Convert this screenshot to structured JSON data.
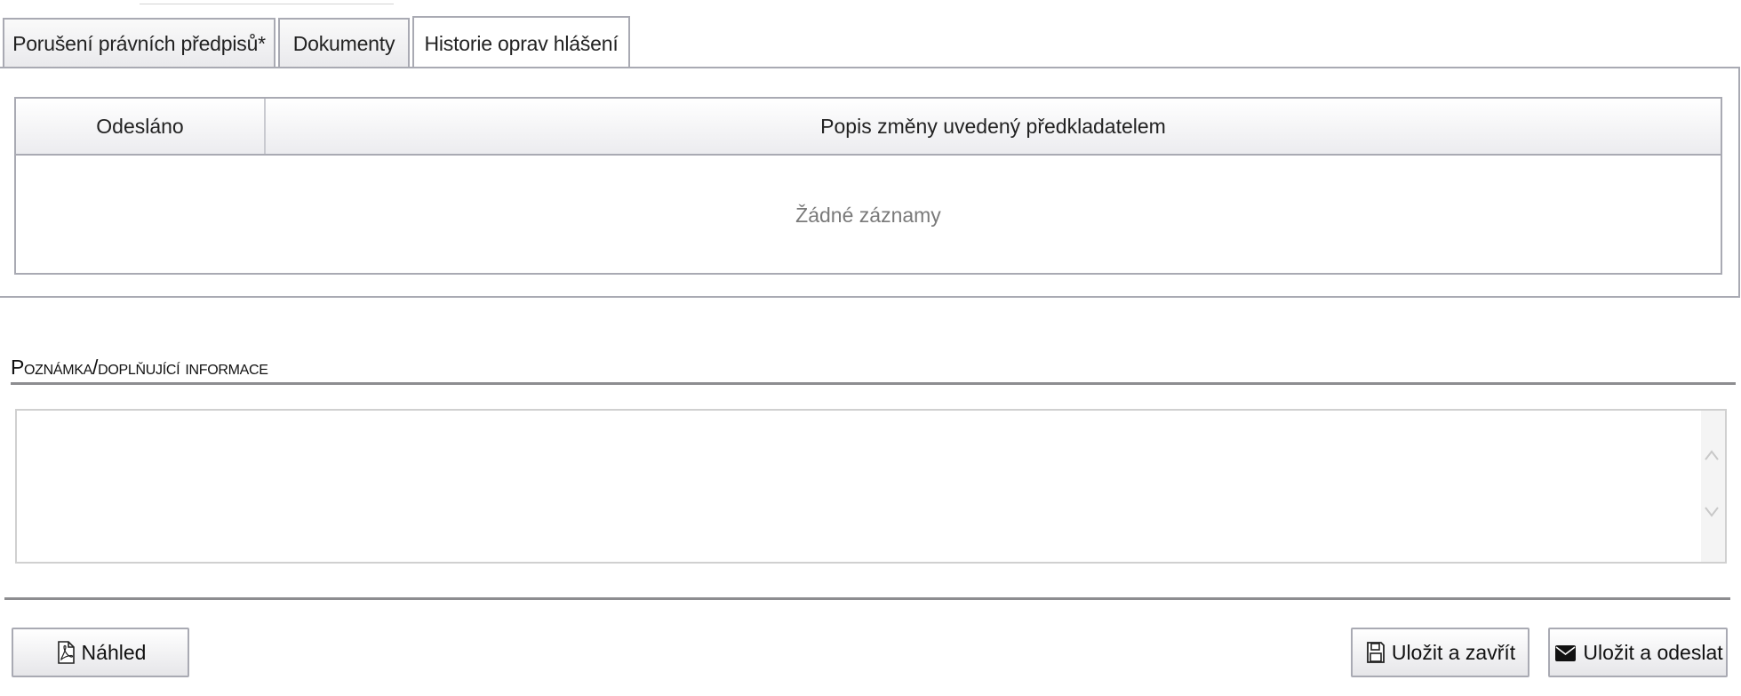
{
  "tabs": [
    {
      "label": "Porušení právních předpisů*"
    },
    {
      "label": "Dokumenty"
    },
    {
      "label": "Historie oprav hlášení",
      "active": true
    }
  ],
  "history_table": {
    "columns": [
      "Odesláno",
      "Popis změny uvedený předkladatelem"
    ],
    "empty_text": "Žádné záznamy"
  },
  "note_section": {
    "title": "Poznámka/doplňující informace",
    "value": ""
  },
  "buttons": {
    "preview": {
      "label": "Náhled",
      "icon": "pdf-file-icon"
    },
    "save_close": {
      "label": "Uložit a zavřít",
      "icon": "floppy-disk-icon"
    },
    "save_send": {
      "label": "Uložit a odeslat",
      "icon": "envelope-icon"
    }
  },
  "colors": {
    "border": "#a9aab3",
    "empty_text": "#7a7a7a",
    "divider": "#8d8d90"
  }
}
